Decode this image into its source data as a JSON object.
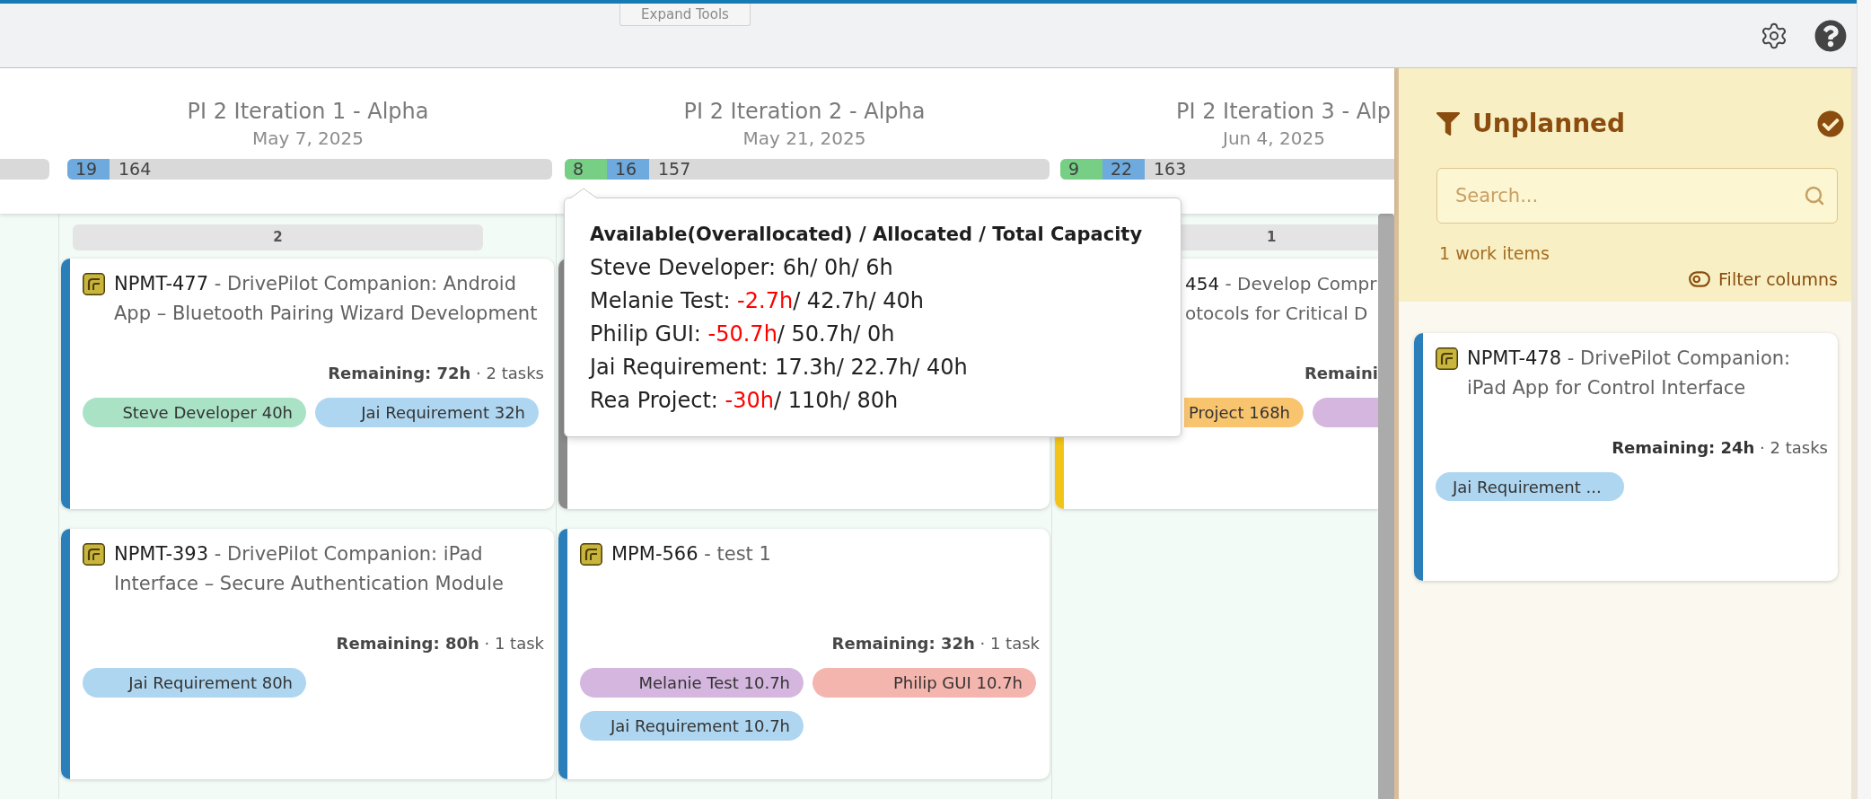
{
  "toolbar": {
    "expand_tools": "Expand Tools"
  },
  "iterations": [
    {
      "title": "PI 2 Iteration 1 - Alpha",
      "date": "May 7, 2025",
      "capacity": [
        {
          "kind": "allocated",
          "value": "19"
        },
        {
          "kind": "total",
          "value": "164"
        }
      ]
    },
    {
      "title": "PI 2 Iteration 2 - Alpha",
      "date": "May 21, 2025",
      "capacity": [
        {
          "kind": "available",
          "value": "8"
        },
        {
          "kind": "allocated",
          "value": "16"
        },
        {
          "kind": "total",
          "value": "157"
        }
      ]
    },
    {
      "title": "PI 2 Iteration 3 - Alp",
      "date": "Jun 4, 2025",
      "capacity": [
        {
          "kind": "available",
          "value": "9"
        },
        {
          "kind": "allocated",
          "value": "22"
        },
        {
          "kind": "total",
          "value": "163"
        }
      ]
    }
  ],
  "capacity_tooltip": {
    "title": "Available(Overallocated) / Allocated / Total Capacity",
    "rows": [
      {
        "person": "Steve Developer:",
        "available": "6h",
        "overallocated": false,
        "rest": "/ 0h/ 6h"
      },
      {
        "person": "Melanie Test:",
        "available": "-2.7h",
        "overallocated": true,
        "rest": "/ 42.7h/ 40h"
      },
      {
        "person": "Philip GUI:",
        "available": "-50.7h",
        "overallocated": true,
        "rest": "/ 50.7h/ 0h"
      },
      {
        "person": "Jai Requirement:",
        "available": "17.3h",
        "overallocated": false,
        "rest": "/ 22.7h/ 40h"
      },
      {
        "person": "Rea Project:",
        "available": "-30h",
        "overallocated": true,
        "rest": "/ 110h/ 80h"
      }
    ]
  },
  "board": {
    "columns": [
      {
        "count": "2",
        "cards": [
          {
            "kind": "full",
            "key": "NPMT-477",
            "title": "- DrivePilot Companion: Android App – Bluetooth Pairing Wizard Development",
            "remaining": "**Remaining: 72h** · 2 tasks",
            "color": "#2a7fba",
            "assignees": [
              {
                "label": "Steve Developer 40h",
                "color": "#a9e2c5"
              },
              {
                "label": "Jai Requirement 32h",
                "color": "#afd6f1"
              }
            ]
          },
          {
            "kind": "full",
            "key": "NPMT-393",
            "title": "- DrivePilot Companion: iPad Interface – Secure Authentication Module",
            "remaining": "**Remaining: 80h** · 1 task",
            "color": "#2a7fba",
            "assignees": [
              {
                "label": "Jai Requirement 80h",
                "color": "#afd6f1"
              }
            ]
          }
        ]
      },
      {
        "cards": [
          {
            "kind": "covered",
            "color": "#8a8a8a"
          },
          {
            "kind": "full",
            "key": "MPM-566",
            "title": "- test 1",
            "remaining": "**Remaining: 32h** · 1 task",
            "color": "#2a7fba",
            "assignees": [
              {
                "label": "Melanie Test 10.7h",
                "color": "#d5b6df"
              },
              {
                "label": "Philip GUI 10.7h",
                "color": "#f4b5ae"
              },
              {
                "label": "Jai Requirement 10.7h",
                "color": "#afd6f1"
              }
            ]
          }
        ]
      },
      {
        "count": "1",
        "cards": [
          {
            "kind": "partial",
            "key": "454",
            "title_lines": [
              "- Develop Compr",
              "otocols for Critical D"
            ],
            "remaining": "Remaini",
            "color": "#f2c417",
            "assignees": [
              {
                "label": "Project 168h",
                "color": "#f9c46e"
              },
              {
                "color": "#d5b6df"
              }
            ]
          }
        ]
      }
    ]
  },
  "unplanned": {
    "title": "Unplanned",
    "search": {
      "placeholder": "Search..."
    },
    "count": "1 work items",
    "filter": "Filter columns",
    "cards": [
      {
        "kind": "full",
        "key": "NPMT-478",
        "title": "- DrivePilot Companion: iPad App for Control Interface",
        "remaining": "**Remaining: 24h** · 2 tasks",
        "color": "#2a7fba",
        "assignees": [
          {
            "label": "Jai Requirement ...",
            "color": "#afd6f1"
          }
        ]
      }
    ]
  }
}
